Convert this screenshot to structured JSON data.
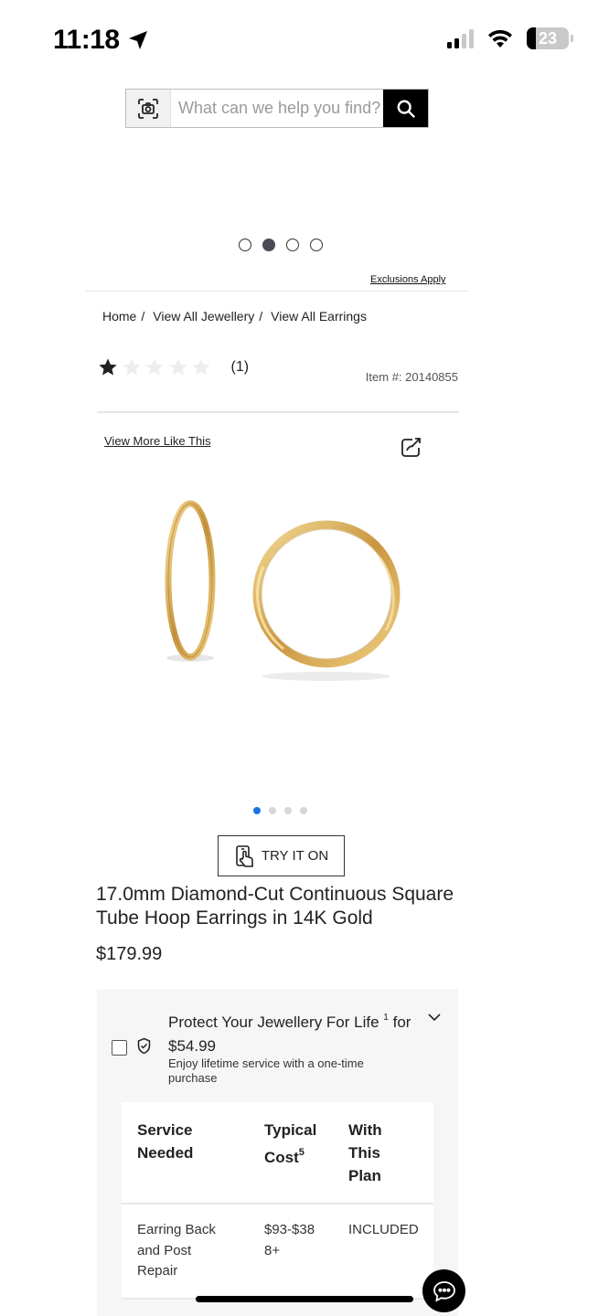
{
  "status_bar": {
    "time": "11:18",
    "battery": "23",
    "icons": [
      "location-arrow-icon",
      "signal-icon",
      "wifi-icon",
      "battery-icon"
    ]
  },
  "search": {
    "placeholder": "What can we help you find?",
    "icons": [
      "camera-search-icon",
      "search-icon"
    ]
  },
  "promo_carousel": {
    "dot_count": 4,
    "active_index": 1,
    "exclusions": "Exclusions Apply"
  },
  "breadcrumb": {
    "items": [
      "Home",
      "View All Jewellery",
      "View All Earrings"
    ],
    "separator": "/"
  },
  "rating": {
    "stars_filled": 1,
    "stars_total": 5,
    "count": "(1)",
    "item_number": "Item #: 20140855"
  },
  "product": {
    "view_more": "View More Like This",
    "image_dots_count": 4,
    "image_active_index": 0,
    "try_on_label": "TRY IT ON",
    "title": "17.0mm Diamond-Cut Continuous Square Tube Hoop Earrings in 14K Gold",
    "price": "$179.99"
  },
  "protection_plan": {
    "heading_prefix": "Protect Your Jewellery For Life",
    "heading_sup": "1",
    "heading_for": "for",
    "plan_price": "$54.99",
    "subtext": "Enjoy lifetime service with a one-time purchase",
    "table": {
      "headers": [
        "Service Needed",
        "Typical Cost",
        "With This Plan"
      ],
      "header_sup": "5",
      "rows": [
        [
          "Earring Back and Post Repair",
          "$93-$388+",
          "INCLUDED"
        ]
      ]
    }
  },
  "colors": {
    "accent_dot": "#1a73e8",
    "gold": "#d4a84a",
    "panel_bg": "#f6f6f6"
  }
}
